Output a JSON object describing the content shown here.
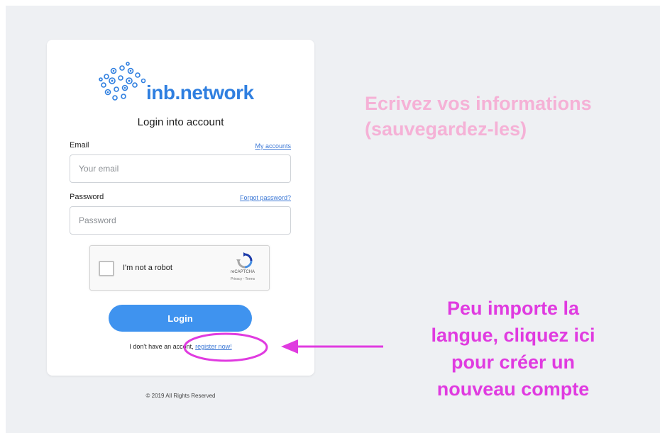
{
  "brand": {
    "name": "inb.network",
    "logo_icon": "network-dots-icon",
    "color": "#2f7fe0"
  },
  "login": {
    "title": "Login into account",
    "email_label": "Email",
    "my_accounts_link": "My accounts",
    "email_placeholder": "Your email",
    "email_value": "",
    "password_label": "Password",
    "forgot_link": "Forgot password?",
    "password_placeholder": "Password",
    "password_value": "",
    "recaptcha": {
      "label": "I'm not a robot",
      "brand": "reCAPTCHA",
      "terms": "Privacy - Terms",
      "checked": false
    },
    "submit_label": "Login",
    "no_account_text_before": "I don't have an acco",
    "no_account_text_after": "nt, ",
    "register_link": "register now!",
    "button_color": "#3f93ef"
  },
  "footer": {
    "copyright": "© 2019 All Rights Reserved"
  },
  "annotations": {
    "top": {
      "line1": "Ecrivez vos informations",
      "line2": "(sauvegardez-les)",
      "color": "#f5b1d6"
    },
    "bottom": {
      "line1": "Peu importe la",
      "line2": "langue, cliquez ici",
      "line3": "pour créer un",
      "line4": "nouveau compte",
      "color": "#e03be0"
    }
  }
}
